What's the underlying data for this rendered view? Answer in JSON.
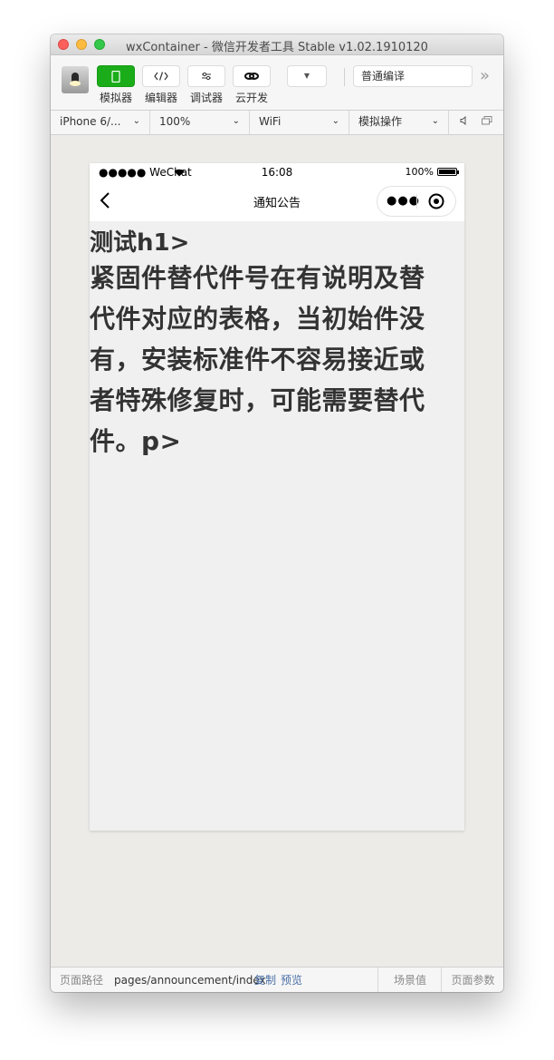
{
  "window": {
    "title": "wxContainer - 微信开发者工具 Stable v1.02.1910120"
  },
  "toolbar": {
    "simulator_label": "模拟器",
    "editor_label": "编辑器",
    "debugger_label": "调试器",
    "cloud_label": "云开发",
    "compile_mode": "普通编译",
    "more_label": "»"
  },
  "device_bar": {
    "device": "iPhone 6/...",
    "zoom": "100%",
    "network": "WiFi",
    "operation": "模拟操作"
  },
  "phone": {
    "status_bar": {
      "carrier": "●●●●● WeChat",
      "time": "16:08",
      "battery": "100%"
    },
    "nav_title": "通知公告",
    "content": {
      "heading": "测试h1>",
      "paragraph": "紧固件替代件号在有说明及替代件对应的表格，当初始件没有，安装标准件不容易接近或者特殊修复时，可能需要替代件。p>"
    }
  },
  "footer": {
    "path_label": "页面路径",
    "path_value": "pages/announcement/index",
    "copy_label": "复制",
    "preview_label": "预览",
    "scene_label": "场景值",
    "params_label": "页面参数"
  },
  "colors": {
    "accent_green": "#1aad19",
    "link_blue": "#4a6fa5",
    "window_bg": "#ecebe8"
  }
}
